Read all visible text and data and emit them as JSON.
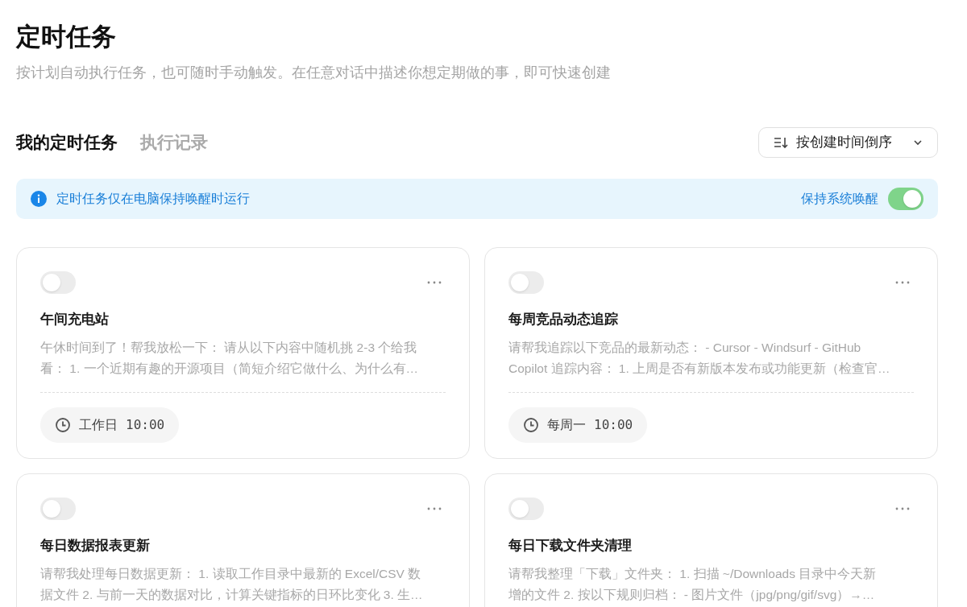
{
  "header": {
    "title": "定时任务",
    "subtitle": "按计划自动执行任务，也可随时手动触发。在任意对话中描述你想定期做的事，即可快速创建"
  },
  "tabs": [
    {
      "label": "我的定时任务",
      "selected": true
    },
    {
      "label": "执行记录",
      "selected": false
    }
  ],
  "sort": {
    "label": "按创建时间倒序"
  },
  "notice": {
    "text": "定时任务仅在电脑保持唤醒时运行",
    "toggle_label": "保持系统唤醒",
    "on": true
  },
  "tasks": [
    {
      "on": false,
      "title": "午间充电站",
      "desc_lines": [
        "午休时间到了！帮我放松一下： 请从以下内容中随机挑 2-3 个给我",
        "看： 1. 一个近期有趣的开源项目（简短介绍它做什么、为什么有…"
      ],
      "schedule": "工作日",
      "time": "10:00"
    },
    {
      "on": false,
      "title": "每周竞品动态追踪",
      "desc_lines": [
        "请帮我追踪以下竞品的最新动态： - Cursor - Windsurf - GitHub",
        "Copilot 追踪内容： 1. 上周是否有新版本发布或功能更新（检查官…"
      ],
      "schedule": "每周一",
      "time": "10:00"
    },
    {
      "on": false,
      "title": "每日数据报表更新",
      "desc_lines": [
        "请帮我处理每日数据更新： 1. 读取工作目录中最新的 Excel/CSV 数",
        "据文件 2. 与前一天的数据对比，计算关键指标的日环比变化 3. 生…"
      ]
    },
    {
      "on": false,
      "title": "每日下载文件夹清理",
      "desc_lines": [
        "请帮我整理「下载」文件夹： 1. 扫描 ~/Downloads 目录中今天新",
        "增的文件 2. 按以下规则归档： - 图片文件（jpg/png/gif/svg）→…"
      ]
    }
  ]
}
